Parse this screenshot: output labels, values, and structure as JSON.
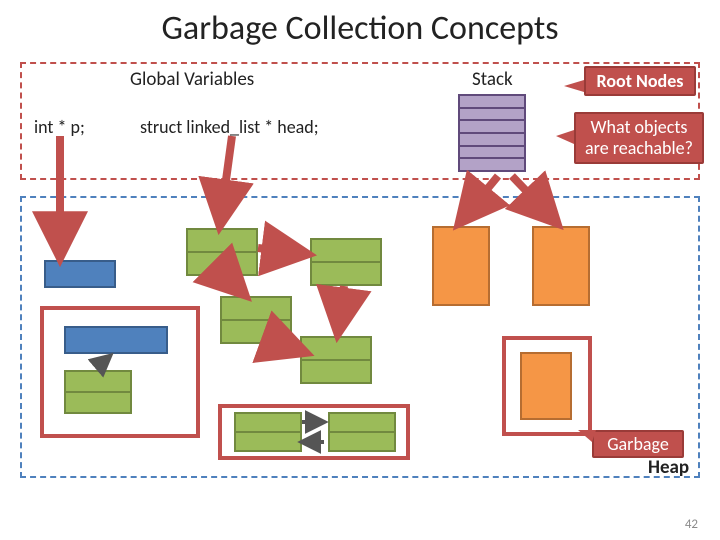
{
  "title": "Garbage Collection Concepts",
  "roots": {
    "global_label": "Global Variables",
    "stack_label": "Stack",
    "var_p": "int * p;",
    "var_head": "struct linked_list * head;"
  },
  "callouts": {
    "root_nodes": "Root Nodes",
    "reachable": "What objects are reachable?",
    "garbage": "Garbage"
  },
  "heap_label": "Heap",
  "page_number": "42"
}
